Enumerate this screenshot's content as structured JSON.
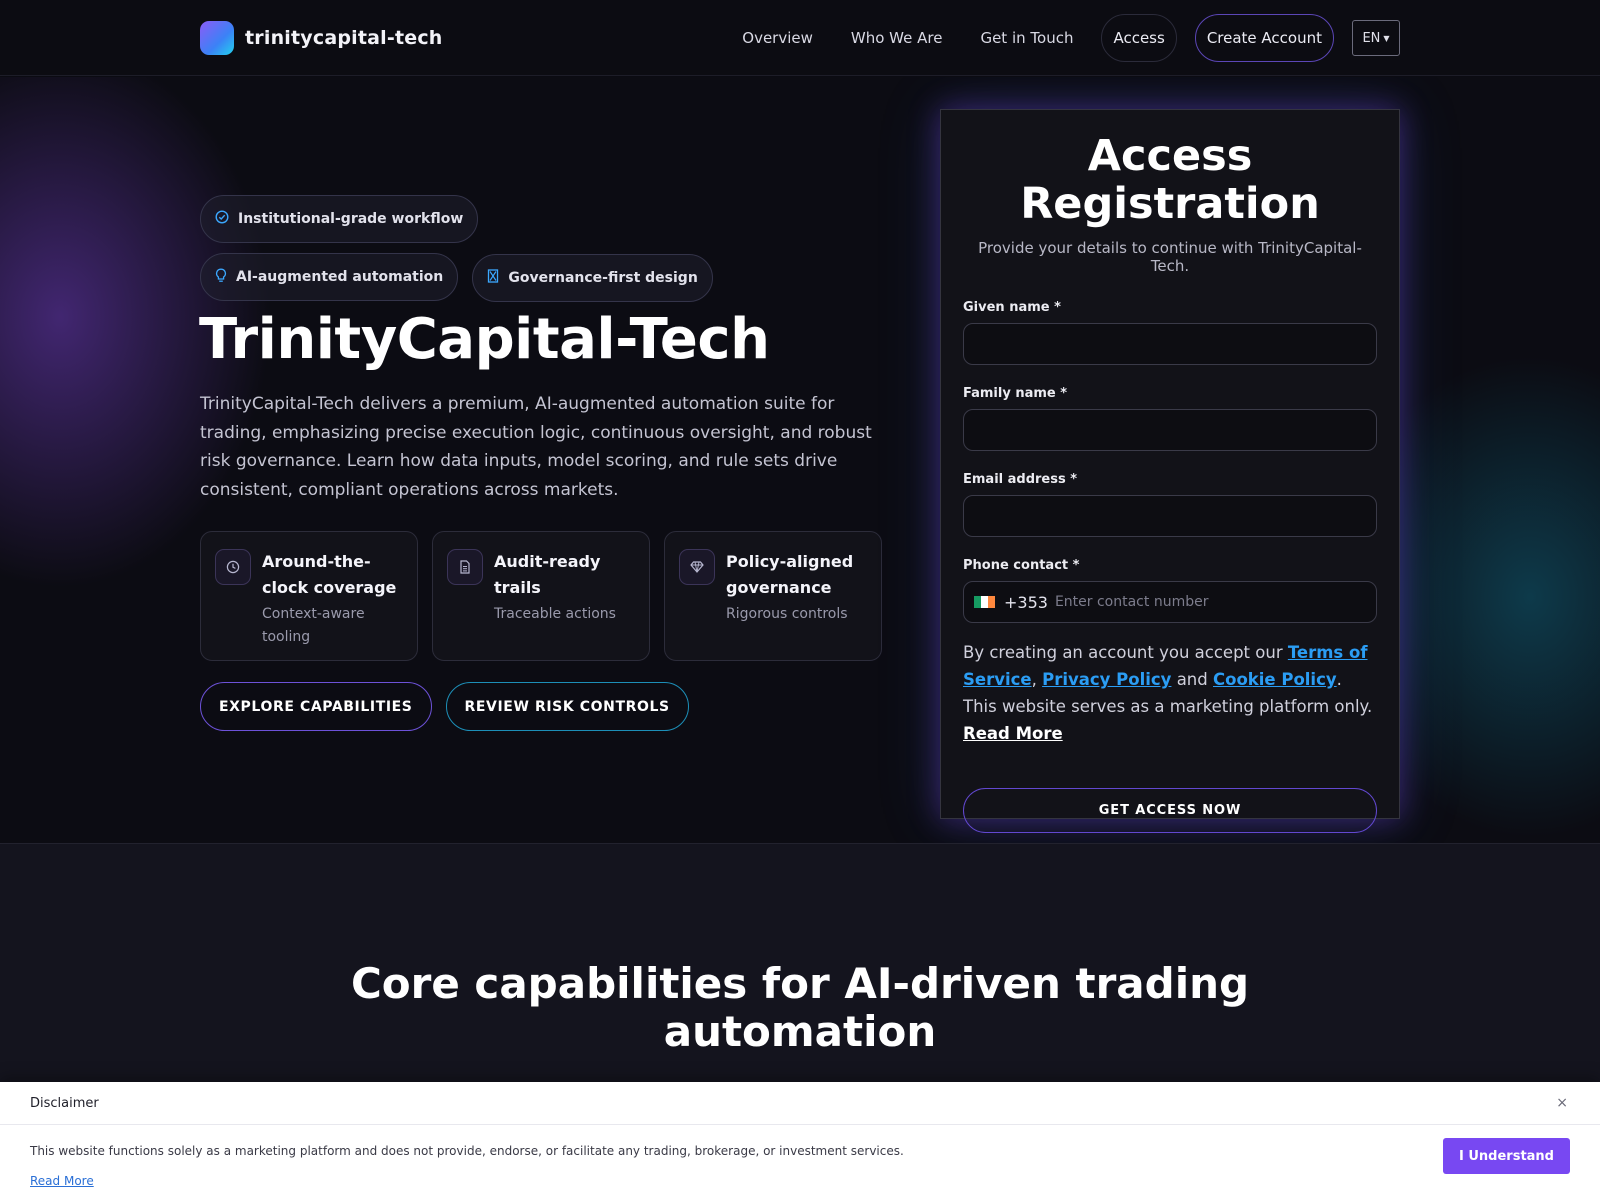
{
  "header": {
    "brand": "trinitycapital-tech",
    "nav": [
      "Overview",
      "Who We Are",
      "Get in Touch"
    ],
    "access_label": "Access",
    "create_account_label": "Create Account",
    "language": "EN"
  },
  "hero": {
    "badges": [
      {
        "icon": "check-circle-icon",
        "label": "Institutional-grade workflow"
      },
      {
        "icon": "lightbulb-icon",
        "label": "AI-augmented automation"
      },
      {
        "icon": "hourglass-icon",
        "label": "Governance-first design"
      }
    ],
    "title": "TrinityCapital-Tech",
    "description": "TrinityCapital-Tech delivers a premium, AI-augmented automation suite for trading, emphasizing precise execution logic, continuous oversight, and robust risk governance. Learn how data inputs, model scoring, and rule sets drive consistent, compliant operations across markets.",
    "features": [
      {
        "icon": "clock-icon",
        "title": "Around-the-clock coverage",
        "subtitle": "Context-aware tooling"
      },
      {
        "icon": "document-icon",
        "title": "Audit-ready trails",
        "subtitle": "Traceable actions"
      },
      {
        "icon": "diamond-icon",
        "title": "Policy-aligned governance",
        "subtitle": "Rigorous controls"
      }
    ],
    "buttons": [
      "EXPLORE CAPABILITIES",
      "REVIEW RISK CONTROLS"
    ]
  },
  "registration": {
    "title": "Access Registration",
    "subtitle": "Provide your details to continue with TrinityCapital-Tech.",
    "given_name_label": "Given name *",
    "family_name_label": "Family name *",
    "email_label": "Email address *",
    "phone_label": "Phone contact *",
    "phone_code": "+353",
    "phone_placeholder": "Enter contact number",
    "consent_prefix": "By creating an account you accept our ",
    "terms_label": "Terms of Service",
    "comma": ", ",
    "privacy_label": "Privacy Policy",
    "and_text": " and ",
    "cookie_label": "Cookie Policy",
    "consent_suffix": ". This website serves as a marketing platform only. ",
    "read_more_label": "Read More",
    "submit_label": "GET ACCESS NOW"
  },
  "capabilities": {
    "title": "Core capabilities for AI-driven trading automation"
  },
  "disclaimer": {
    "title": "Disclaimer",
    "close": "×",
    "text": "This website functions solely as a marketing platform and does not provide, endorse, or facilitate any trading, brokerage, or investment services.",
    "read_more": "Read More",
    "button": "I Understand"
  },
  "colors": {
    "accent_purple": "#7848f2",
    "accent_blue": "#2b9df4",
    "background": "#0c0c13",
    "flag": [
      "#169b62",
      "#ffffff",
      "#ff883e"
    ]
  }
}
